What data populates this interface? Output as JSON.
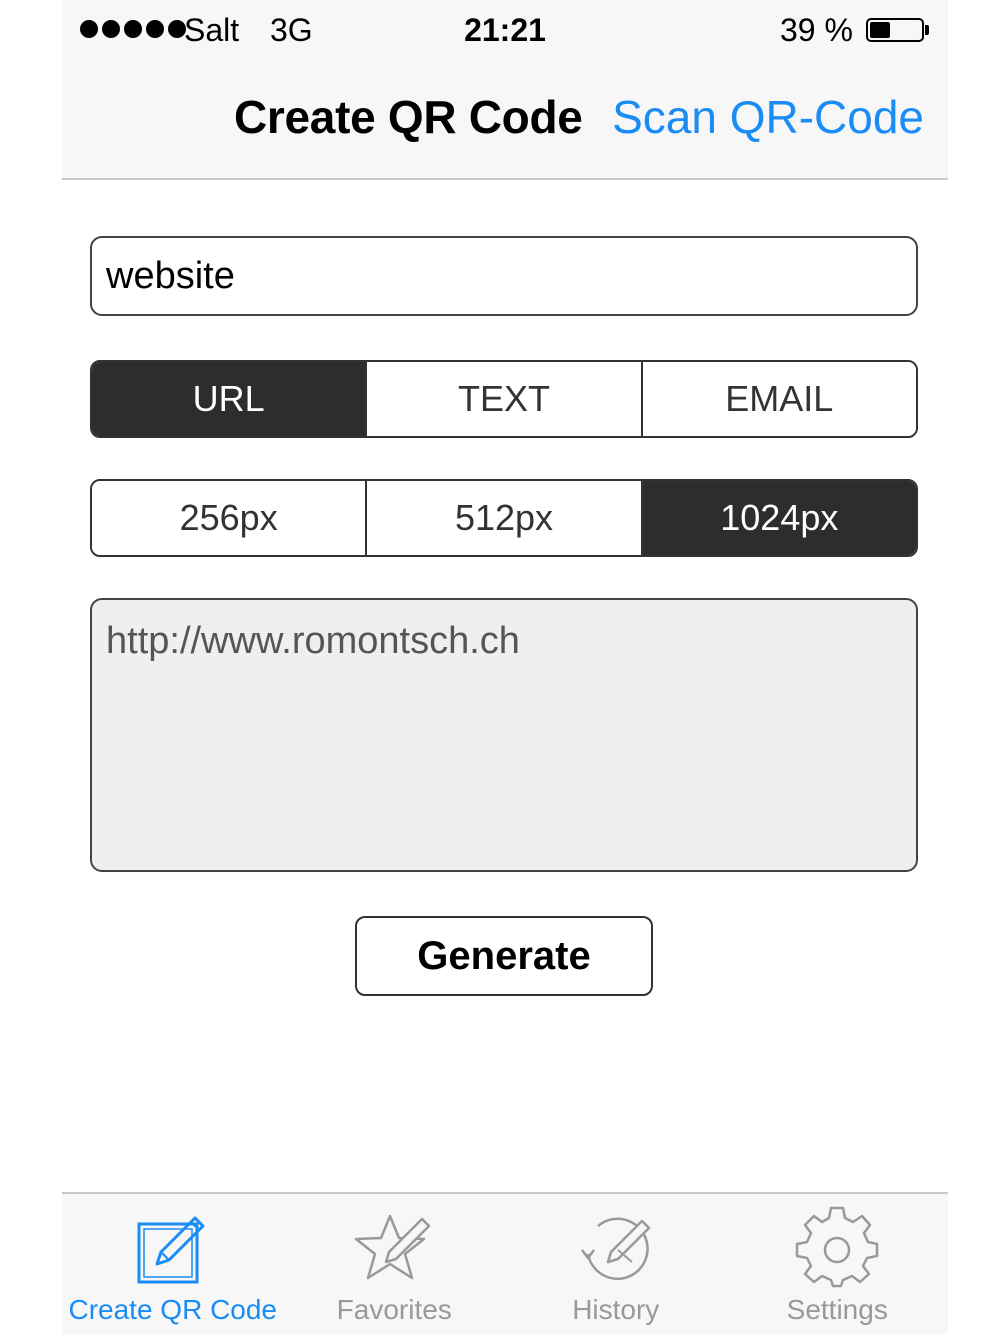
{
  "status_bar": {
    "carrier": "Salt",
    "network": "3G",
    "time": "21:21",
    "battery_percent": "39 %",
    "battery_level": 0.39,
    "signal_bars": 5
  },
  "nav": {
    "title": "Create QR Code",
    "right_link": "Scan QR-Code"
  },
  "form": {
    "name_value": "website",
    "type_options": [
      "URL",
      "TEXT",
      "EMAIL"
    ],
    "type_selected": "URL",
    "size_options": [
      "256px",
      "512px",
      "1024px"
    ],
    "size_selected": "1024px",
    "content_value": "http://www.romontsch.ch",
    "generate_label": "Generate"
  },
  "tabbar": {
    "items": [
      {
        "label": "Create QR Code",
        "icon": "pencil-square-icon",
        "active": true
      },
      {
        "label": "Favorites",
        "icon": "star-pencil-icon",
        "active": false
      },
      {
        "label": "History",
        "icon": "clock-pencil-icon",
        "active": false
      },
      {
        "label": "Settings",
        "icon": "gear-icon",
        "active": false
      }
    ]
  },
  "colors": {
    "accent": "#1a8cf5",
    "segment_active": "#2d2d2d",
    "inactive_tab": "#999999"
  }
}
